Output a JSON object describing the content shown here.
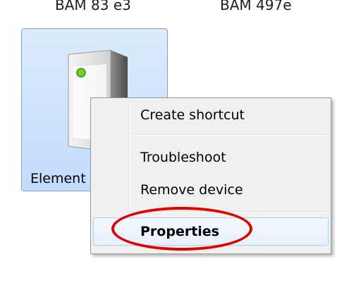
{
  "desktop": {
    "labels": [
      "BAM 83 e3",
      "BAM 497e"
    ]
  },
  "device": {
    "name": "Element",
    "icon": "storage-drive-icon"
  },
  "context_menu": {
    "items": [
      {
        "label": "Create shortcut"
      },
      {
        "label": "Troubleshoot"
      },
      {
        "label": "Remove device"
      },
      {
        "label": "Properties",
        "bold": true,
        "highlighted": true
      }
    ]
  },
  "annotation": {
    "color": "#e00000",
    "shape": "ellipse-around-properties"
  }
}
